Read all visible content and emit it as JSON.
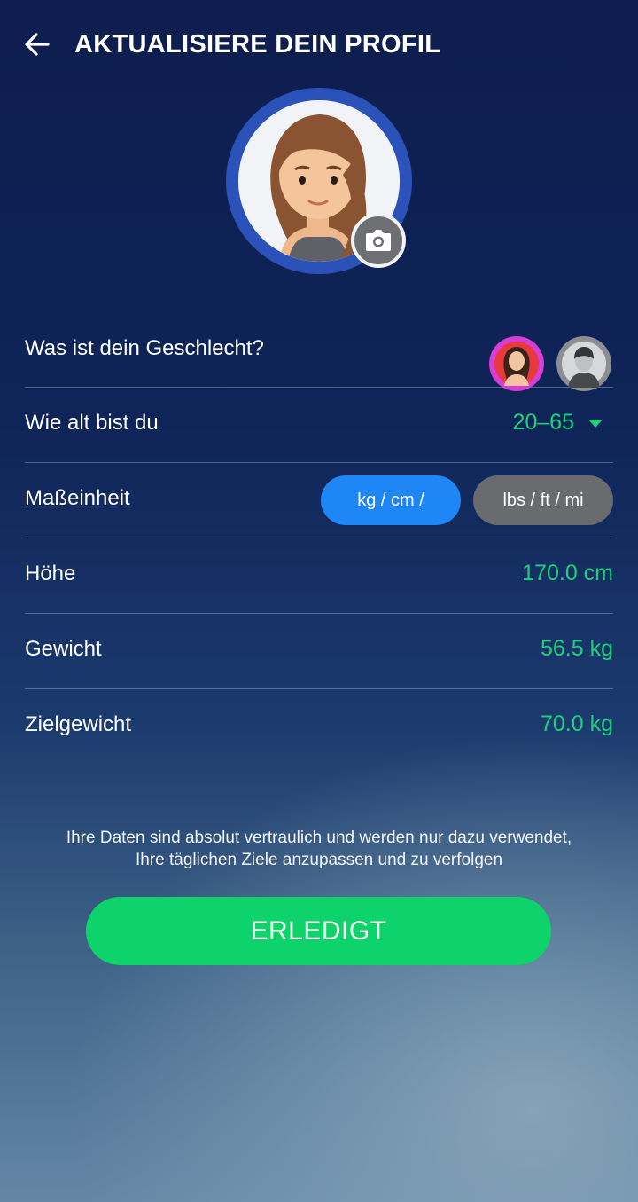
{
  "header": {
    "title": "AKTUALISIERE DEIN PROFIL",
    "back_icon": "arrow-left-icon"
  },
  "avatar": {
    "icon": "female-avatar-icon",
    "ring_color": "#2a52b8",
    "camera_icon": "camera-icon"
  },
  "form": {
    "gender": {
      "label": "Was ist dein Geschlecht?",
      "options": [
        "female-avatar-icon",
        "male-avatar-icon"
      ]
    },
    "age": {
      "label": "Wie alt bist du",
      "value": "20–65",
      "icon": "caret-down-icon"
    },
    "unit": {
      "label": "Maßeinheit",
      "options": [
        "kg / cm /",
        "lbs / ft / mi"
      ],
      "selected": "kg / cm /"
    },
    "height": {
      "label": "Höhe",
      "value": "170.0  cm"
    },
    "weight": {
      "label": "Gewicht",
      "value": "56.5  kg"
    },
    "target_weight": {
      "label": "Zielgewicht",
      "value": "70.0  kg"
    }
  },
  "privacy_note": {
    "line1": "Ihre Daten sind absolut vertraulich und werden nur dazu verwendet,",
    "line2": "Ihre täglichen Ziele anzupassen und zu verfolgen"
  },
  "done_button": {
    "label": "ERLEDIGT"
  },
  "colors": {
    "accent_green": "#1fd07a",
    "button_green": "#0ed36b",
    "selected_blue": "#1e86f5",
    "unselected_gray": "#6a6b6f"
  }
}
